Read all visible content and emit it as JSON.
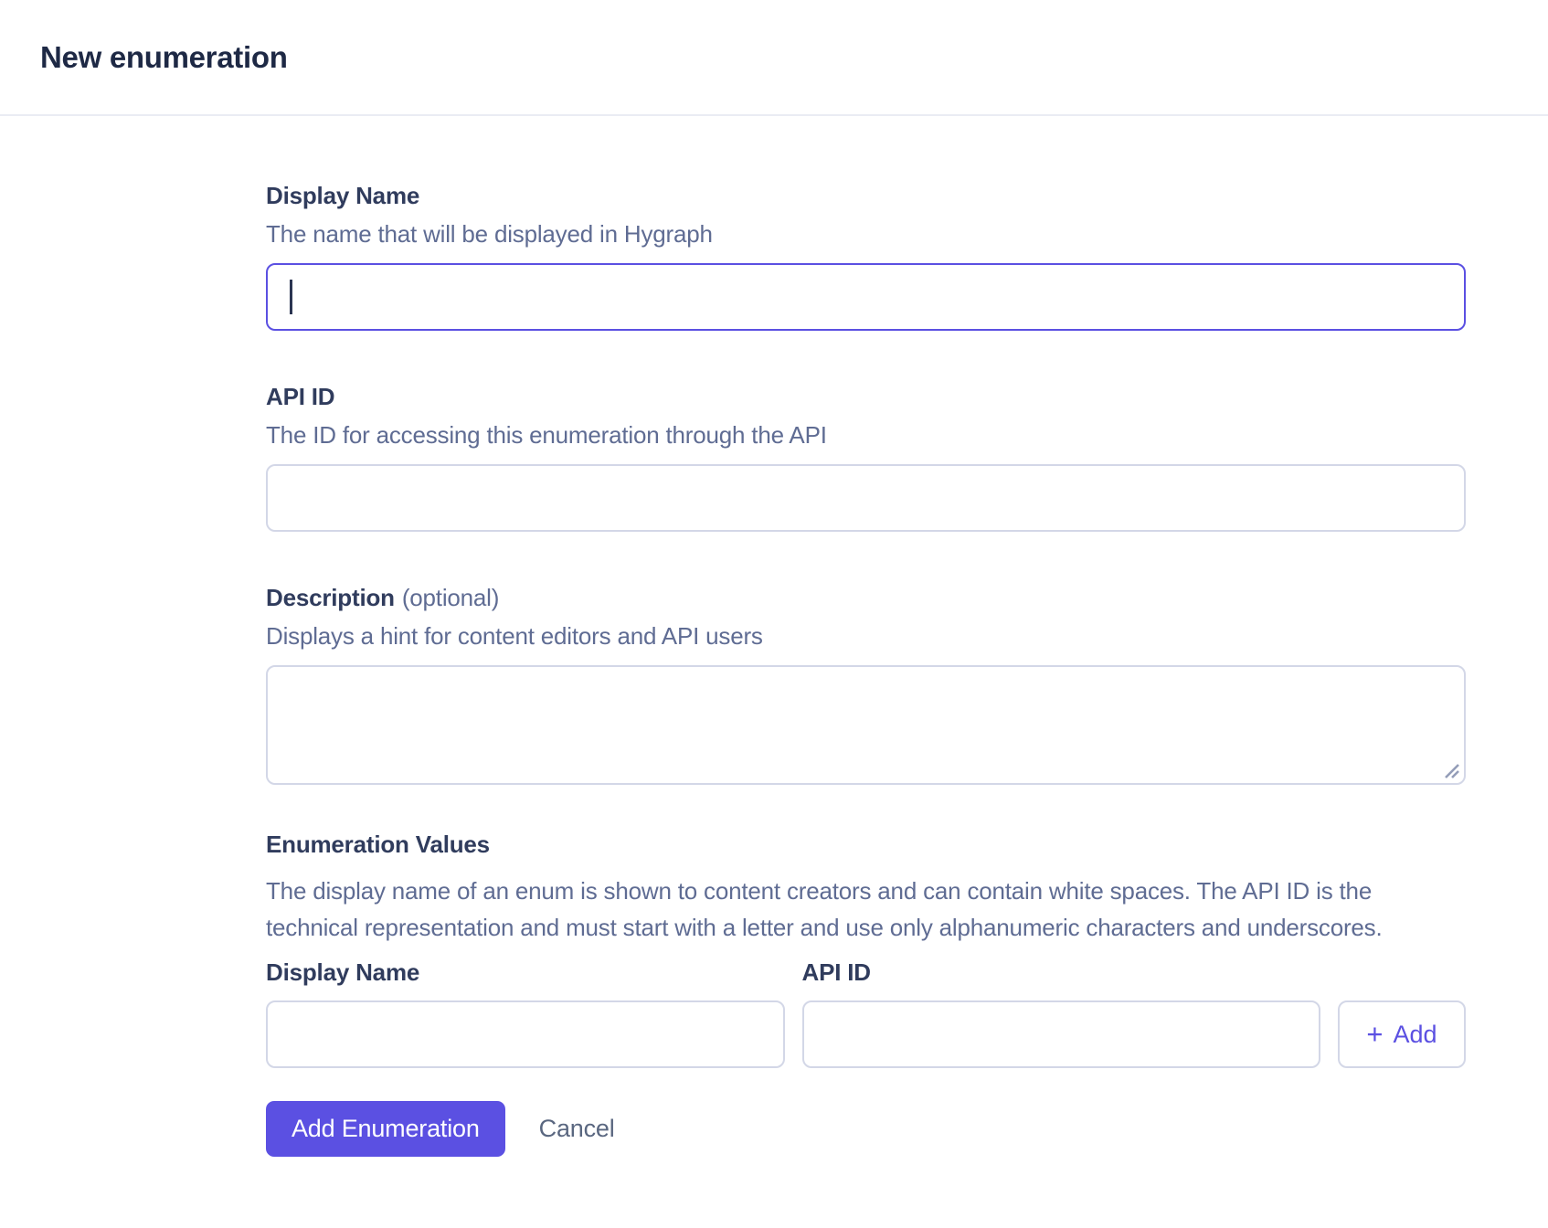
{
  "header": {
    "title": "New enumeration"
  },
  "form": {
    "display_name": {
      "label": "Display Name",
      "hint": "The name that will be displayed in Hygraph",
      "value": ""
    },
    "api_id": {
      "label": "API ID",
      "hint": "The ID for accessing this enumeration through the API",
      "value": ""
    },
    "description": {
      "label": "Description",
      "optional": "(optional)",
      "hint": "Displays a hint for content editors and API users",
      "value": ""
    },
    "enumeration_values": {
      "heading": "Enumeration Values",
      "description": "The display name of an enum is shown to content creators and can contain white spaces. The API ID is the technical representation and must start with a letter and use only alphanumeric characters and underscores.",
      "display_name_label": "Display Name",
      "api_id_label": "API ID",
      "display_name_value": "",
      "api_id_value": "",
      "add_button": {
        "icon": "+",
        "label": "Add"
      }
    },
    "actions": {
      "submit": "Add Enumeration",
      "cancel": "Cancel"
    }
  },
  "colors": {
    "accent": "#5B50E2",
    "focused_input_border": "#5B50E2",
    "input_border": "#D3D7E7",
    "title_text": "#1E2945",
    "label_text": "#303C5D",
    "hint_text": "#5F6C93",
    "cancel_text": "#5A6780",
    "divider": "#EAECF3",
    "background": "#FFFFFF"
  }
}
